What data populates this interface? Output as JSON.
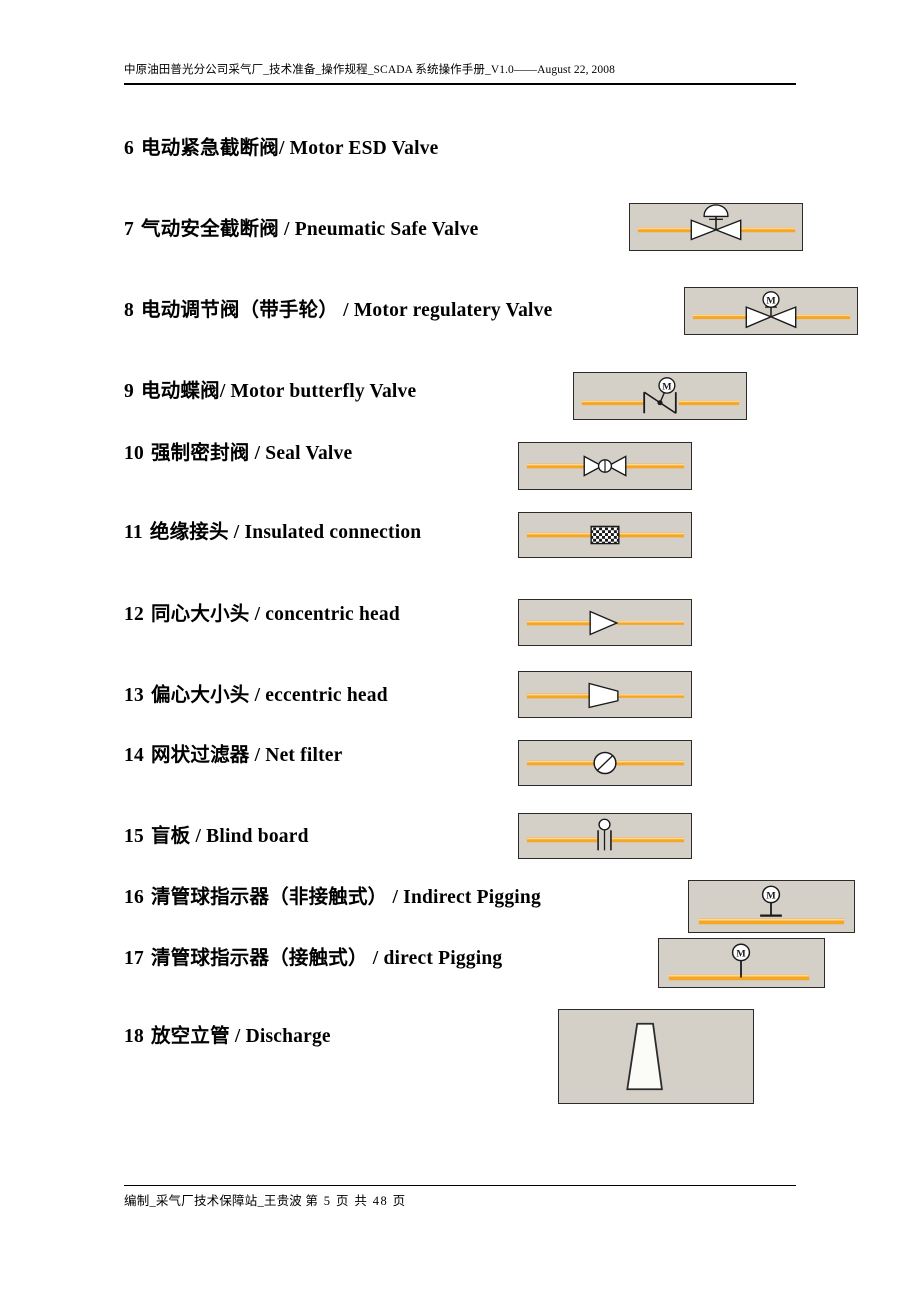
{
  "document": {
    "header": "中原油田普光分公司采气厂_技术准备_操作规程_SCADA 系统操作手册_V1.0——August 22, 2008",
    "footer": "编制_采气厂技术保障站_王贵波　第 5 页 共 48 页",
    "footer_author": "编制_采气厂技术保障站_王贵波",
    "footer_page": "第 5 页 共 48 页",
    "page_number": "5",
    "total_pages": "48"
  },
  "colors": {
    "pipe_orange": "#f5a623",
    "pipe_highlight": "#ffd27f",
    "symbol_bg": "#d4d0c8",
    "symbol_border": "#2b2b2b",
    "text": "#000000"
  },
  "items": [
    {
      "num": "6",
      "cn": "电动紧急截断阀",
      "sep": "/ ",
      "en": "Motor ESD Valve",
      "icon": "none"
    },
    {
      "num": "7",
      "cn": "气动安全截断阀",
      "sep": " / ",
      "en": "Pneumatic Safe Valve",
      "icon": "pneumatic-safe-valve-symbol"
    },
    {
      "num": "8",
      "cn": "电动调节阀（带手轮）",
      "sep": " / ",
      "en": "Motor regulatery Valve",
      "icon": "motor-regulatery-valve-symbol"
    },
    {
      "num": "9",
      "cn": "电动蝶阀",
      "sep": "/ ",
      "en": "Motor butterfly Valve",
      "icon": "motor-butterfly-valve-symbol"
    },
    {
      "num": "10",
      "cn": "强制密封阀",
      "sep": " / ",
      "en": "Seal Valve",
      "icon": "seal-valve-symbol"
    },
    {
      "num": "11",
      "cn": "绝缘接头",
      "sep": " / ",
      "en": "Insulated connection",
      "icon": "insulated-connection-symbol"
    },
    {
      "num": "12",
      "cn": "同心大小头",
      "sep": " / ",
      "en": "concentric head",
      "icon": "concentric-head-symbol"
    },
    {
      "num": "13",
      "cn": "偏心大小头",
      "sep": " / ",
      "en": "eccentric head",
      "icon": "eccentric-head-symbol"
    },
    {
      "num": "14",
      "cn": "网状过滤器",
      "sep": " / ",
      "en": "Net filter",
      "icon": "net-filter-symbol"
    },
    {
      "num": "15",
      "cn": "盲板",
      "sep": " / ",
      "en": "Blind board",
      "icon": "blind-board-symbol"
    },
    {
      "num": "16",
      "cn": "清管球指示器（非接触式）",
      "sep": " / ",
      "en": "Indirect Pigging",
      "icon": "indirect-pigging-symbol"
    },
    {
      "num": "17",
      "cn": "清管球指示器（接触式）",
      "sep": " / ",
      "en": "direct Pigging",
      "icon": "direct-pigging-symbol"
    },
    {
      "num": "18",
      "cn": "放空立管",
      "sep": " / ",
      "en": "Discharge",
      "icon": "discharge-stack-symbol"
    }
  ],
  "symbol_glyph_label": "M"
}
